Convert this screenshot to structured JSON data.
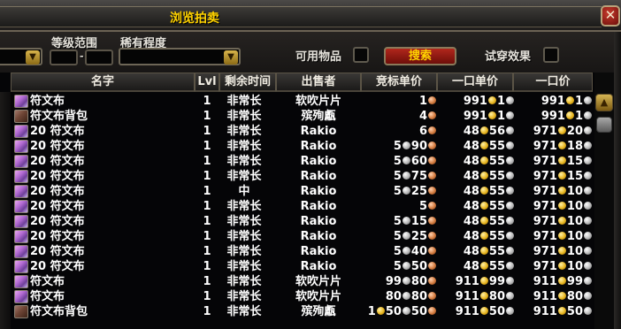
{
  "window": {
    "title": "浏览拍卖",
    "close_label": "✕"
  },
  "filters": {
    "level_range_label": "等级范围",
    "level_separator": "-",
    "rarity_label": "稀有程度",
    "usable_label": "可用物品",
    "search_label": "搜索",
    "preview_label": "试穿效果"
  },
  "columns": {
    "name": "名字",
    "level": "Lvl",
    "time_left": "剩余时间",
    "seller": "出售者",
    "bid": "竞标单价",
    "buyout": "一口单价",
    "buyout_total": "一口价"
  },
  "rows": [
    {
      "name": "符文布",
      "icon": "runecloth-icon",
      "level": "1",
      "time": "非常长",
      "seller": "软吹片片",
      "bid": "1",
      "buy1": "991 1",
      "buy2": "991 1"
    },
    {
      "name": "符文布背包",
      "icon": "bag-icon",
      "level": "1",
      "time": "非常长",
      "seller": "殡殉甗",
      "bid": "4",
      "buy1": "991 1",
      "buy2": "991 1"
    },
    {
      "name": "20 符文布",
      "icon": "runecloth-icon",
      "level": "1",
      "time": "非常长",
      "seller": "Rakio",
      "bid": "6",
      "buy1": "48 56",
      "buy2": "971 20"
    },
    {
      "name": "20 符文布",
      "icon": "runecloth-icon",
      "level": "1",
      "time": "非常长",
      "seller": "Rakio",
      "bid": "5 90",
      "buy1": "48 55",
      "buy2": "971 18"
    },
    {
      "name": "20 符文布",
      "icon": "runecloth-icon",
      "level": "1",
      "time": "非常长",
      "seller": "Rakio",
      "bid": "5 60",
      "buy1": "48 55",
      "buy2": "971 15"
    },
    {
      "name": "20 符文布",
      "icon": "runecloth-icon",
      "level": "1",
      "time": "非常长",
      "seller": "Rakio",
      "bid": "5 75",
      "buy1": "48 55",
      "buy2": "971 15"
    },
    {
      "name": "20 符文布",
      "icon": "runecloth-icon",
      "level": "1",
      "time": "中",
      "seller": "Rakio",
      "bid": "5 25",
      "buy1": "48 55",
      "buy2": "971 10"
    },
    {
      "name": "20 符文布",
      "icon": "runecloth-icon",
      "level": "1",
      "time": "非常长",
      "seller": "Rakio",
      "bid": "5",
      "buy1": "48 55",
      "buy2": "971 10"
    },
    {
      "name": "20 符文布",
      "icon": "runecloth-icon",
      "level": "1",
      "time": "非常长",
      "seller": "Rakio",
      "bid": "5 15",
      "buy1": "48 55",
      "buy2": "971 10"
    },
    {
      "name": "20 符文布",
      "icon": "runecloth-icon",
      "level": "1",
      "time": "非常长",
      "seller": "Rakio",
      "bid": "5 25",
      "buy1": "48 55",
      "buy2": "971 10"
    },
    {
      "name": "20 符文布",
      "icon": "runecloth-icon",
      "level": "1",
      "time": "非常长",
      "seller": "Rakio",
      "bid": "5 40",
      "buy1": "48 55",
      "buy2": "971 10"
    },
    {
      "name": "20 符文布",
      "icon": "runecloth-icon",
      "level": "1",
      "time": "非常长",
      "seller": "Rakio",
      "bid": "5 50",
      "buy1": "48 55",
      "buy2": "971 10"
    },
    {
      "name": "符文布",
      "icon": "runecloth-icon",
      "level": "1",
      "time": "非常长",
      "seller": "软吹片片",
      "bid": "99 80",
      "buy1": "911 99",
      "buy2": "911 99"
    },
    {
      "name": "符文布",
      "icon": "runecloth-icon",
      "level": "1",
      "time": "非常长",
      "seller": "软吹片片",
      "bid": "80 80",
      "buy1": "911 80",
      "buy2": "911 80"
    },
    {
      "name": "符文布背包",
      "icon": "bag-icon",
      "level": "1",
      "time": "非常长",
      "seller": "殡殉甗",
      "bid": "1 50 50",
      "buy1": "911 50",
      "buy2": "911 50"
    }
  ],
  "coin_colors": {
    "gold": "#e8b520",
    "silver": "#b8b8b8",
    "copper": "#d37a3e"
  },
  "scrollbar": {
    "up_icon": "▲"
  }
}
